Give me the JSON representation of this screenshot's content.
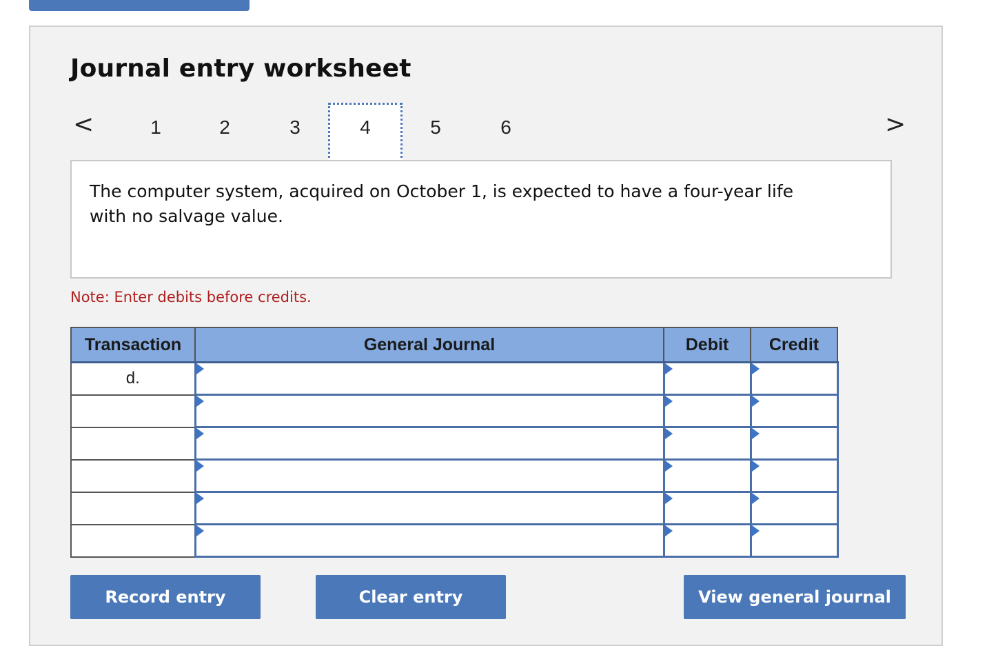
{
  "header": {
    "title": "Journal entry worksheet"
  },
  "nav": {
    "prev_glyph": "<",
    "next_glyph": ">",
    "steps": [
      "1",
      "2",
      "3",
      "4",
      "5",
      "6"
    ],
    "active_step": "4"
  },
  "description": {
    "text": "The computer system, acquired on October 1, is expected to have a four-year life with no salvage value."
  },
  "note": {
    "text": "Note: Enter debits before credits."
  },
  "table": {
    "headers": {
      "transaction": "Transaction",
      "general_journal": "General Journal",
      "debit": "Debit",
      "credit": "Credit"
    },
    "rows": [
      {
        "transaction": "d.",
        "account": "",
        "debit": "",
        "credit": ""
      },
      {
        "transaction": "",
        "account": "",
        "debit": "",
        "credit": ""
      },
      {
        "transaction": "",
        "account": "",
        "debit": "",
        "credit": ""
      },
      {
        "transaction": "",
        "account": "",
        "debit": "",
        "credit": ""
      },
      {
        "transaction": "",
        "account": "",
        "debit": "",
        "credit": ""
      },
      {
        "transaction": "",
        "account": "",
        "debit": "",
        "credit": ""
      }
    ]
  },
  "buttons": {
    "record": "Record entry",
    "clear": "Clear entry",
    "view": "View general journal"
  },
  "colors": {
    "accent": "#4a78b8",
    "header_bg": "#84aae0",
    "note": "#b02020",
    "panel_bg": "#f2f2f2"
  }
}
